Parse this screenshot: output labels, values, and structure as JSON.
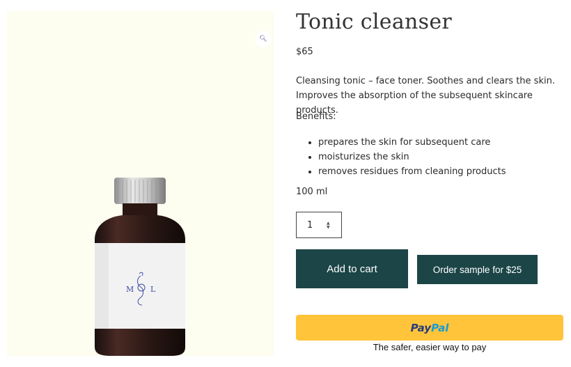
{
  "product": {
    "title": "Tonic cleanser",
    "price": "$65",
    "description": "Cleansing tonic – face toner. Soothes and clears the skin. Improves the absorption of the subsequent skincare products.",
    "benefits_heading": "Benefits:",
    "benefits": [
      "prepares the skin for subsequent care",
      "moisturizes the skin",
      "removes residues from cleaning products"
    ],
    "volume": "100 ml",
    "quantity": "1",
    "label_left": "M",
    "label_right": "L"
  },
  "actions": {
    "add_to_cart": "Add to cart",
    "order_sample": "Order sample for $25"
  },
  "paypal": {
    "brand_pay": "Pay",
    "brand_pal": "Pal",
    "tagline": "The safer, easier way to pay"
  },
  "icons": {
    "zoom": "magnifier-icon",
    "stepper": "chevron-up-down-icon"
  },
  "colors": {
    "primary_button": "#1b4547",
    "paypal_button": "#ffc439",
    "gallery_background": "#fdfdf0"
  }
}
